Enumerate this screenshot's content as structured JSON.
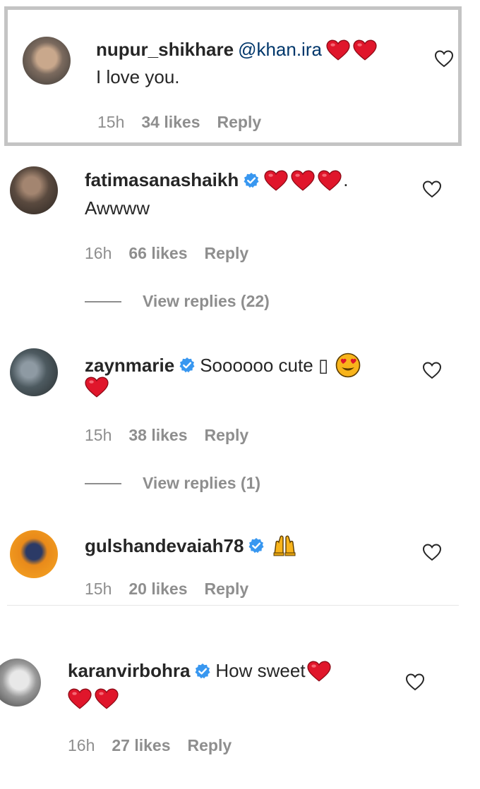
{
  "comments": [
    {
      "username": "nupur_shikhare",
      "mention": "@khan.ira",
      "text": "I love you.",
      "time": "15h",
      "likes": "34 likes",
      "reply": "Reply"
    },
    {
      "username": "fatimasanashaikh",
      "suffix": ".",
      "text": "Awwww",
      "time": "16h",
      "likes": "66 likes",
      "reply": "Reply",
      "view_replies": "View replies (22)"
    },
    {
      "username": "zaynmarie",
      "text": "Soooooo cute ▯",
      "time": "15h",
      "likes": "38 likes",
      "reply": "Reply",
      "view_replies": "View replies (1)"
    },
    {
      "username": "gulshandevaiah78",
      "time": "15h",
      "likes": "20 likes",
      "reply": "Reply"
    },
    {
      "username": "karanvirbohra",
      "text": "How sweet",
      "time": "16h",
      "likes": "27 likes",
      "reply": "Reply"
    }
  ],
  "icons": {
    "heart_emoji": "red-heart-emoji",
    "verified": "verified-badge-icon",
    "like": "heart-outline-icon",
    "heart_eyes": "heart-eyes-emoji",
    "raising_hands": "raising-hands-emoji"
  },
  "colors": {
    "heart_red": "#e0162b",
    "verified_blue": "#3897f0",
    "mention": "#00376b",
    "meta_gray": "#8e8e8e",
    "highlight_border": "#c4c4c4"
  }
}
